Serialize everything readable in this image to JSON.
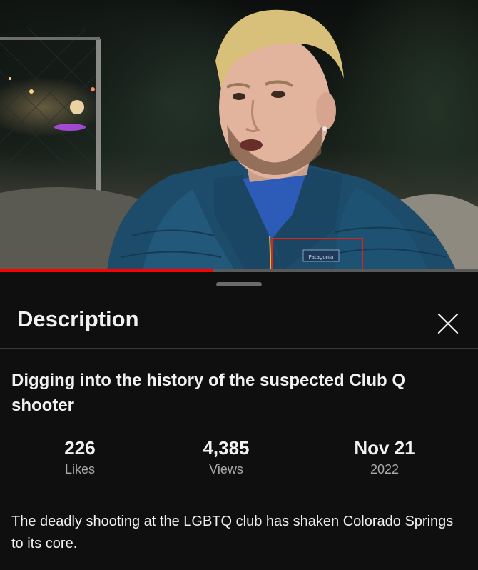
{
  "video": {
    "shirt_logo_text": "Patagonia",
    "progress_fraction": 0.445,
    "highlight_color": "#e0201a"
  },
  "sheet": {
    "title": "Description",
    "close_icon": "close-icon"
  },
  "details": {
    "title": "Digging into the history of the suspected Club Q shooter",
    "stats": [
      {
        "value": "226",
        "label": "Likes"
      },
      {
        "value": "4,385",
        "label": "Views"
      },
      {
        "value": "Nov 21",
        "label": "2022"
      }
    ],
    "description": "The deadly shooting at the LGBTQ club has shaken Colorado Springs to its core."
  },
  "colors": {
    "background": "#0f0f0f",
    "progress": "#ff0000",
    "text_primary": "#f1f1f1",
    "text_secondary": "#aaaaaa"
  }
}
